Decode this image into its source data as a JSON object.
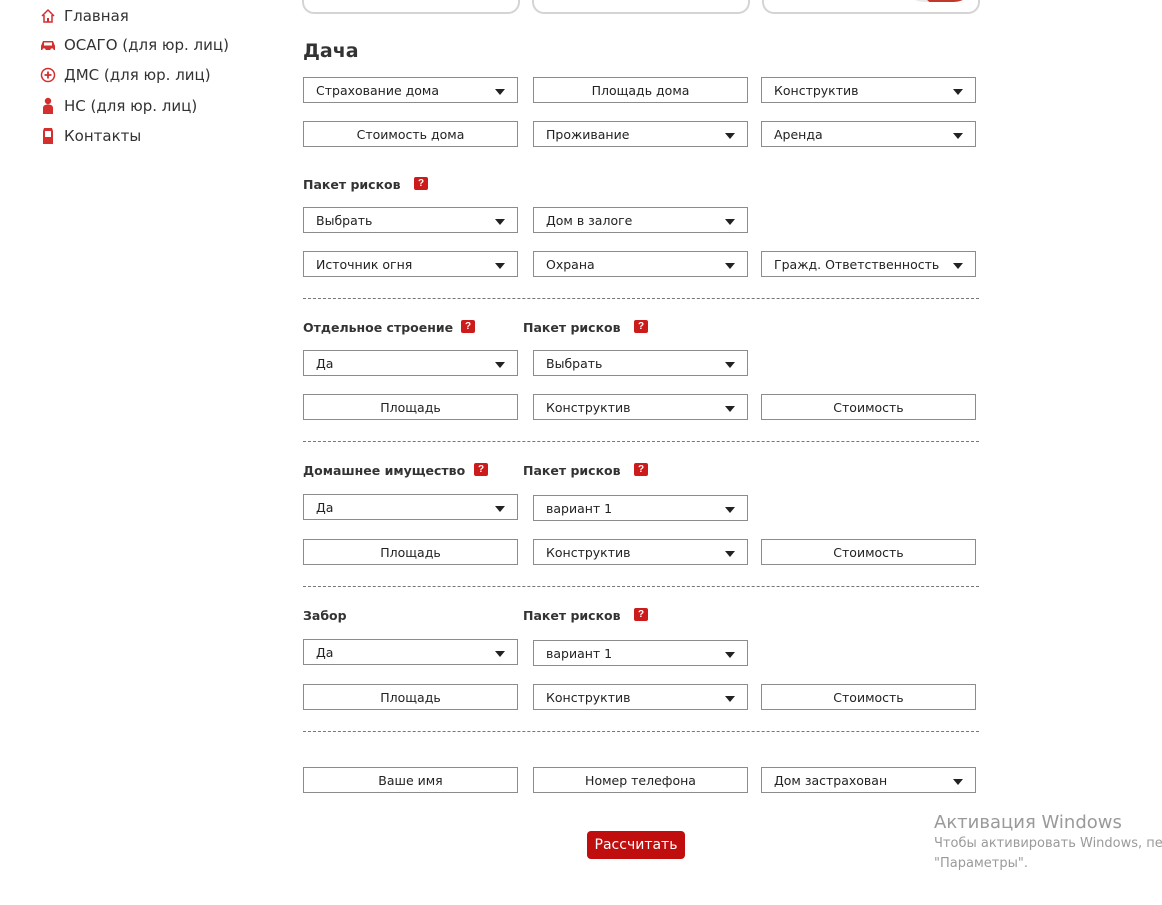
{
  "sidebar": {
    "items": [
      {
        "label": "Главная",
        "icon": "home-icon"
      },
      {
        "label": "ОСАГО (для юр. лиц)",
        "icon": "car-icon"
      },
      {
        "label": "ДМС (для юр. лиц)",
        "icon": "medical-cross-icon"
      },
      {
        "label": "НС (для юр. лиц)",
        "icon": "person-icon"
      },
      {
        "label": "Контакты",
        "icon": "phone-icon"
      }
    ],
    "accent_color": "#d32f2f"
  },
  "section": {
    "title": "Дача"
  },
  "main": {
    "row1": [
      {
        "type": "select",
        "value": "Страхование дома"
      },
      {
        "type": "input",
        "placeholder": "Площадь дома"
      },
      {
        "type": "select",
        "value": "Конструктив"
      }
    ],
    "row2": [
      {
        "type": "input",
        "placeholder": "Стоимость дома"
      },
      {
        "type": "select",
        "value": "Проживание"
      },
      {
        "type": "select",
        "value": "Аренда"
      }
    ],
    "risks": {
      "label": "Пакет рисков",
      "help": "?",
      "row1": [
        {
          "type": "select",
          "value": "Выбрать"
        },
        {
          "type": "select",
          "value": "Дом в залоге"
        }
      ],
      "row2": [
        {
          "type": "select",
          "value": "Источник огня"
        },
        {
          "type": "select",
          "value": "Охрана"
        },
        {
          "type": "select",
          "value": "Гражд. Ответственность"
        }
      ]
    }
  },
  "building": {
    "label": "Отдельное строение",
    "help": "?",
    "package_label": "Пакет рисков",
    "row1": [
      {
        "type": "select",
        "value": "Да"
      },
      {
        "type": "select",
        "value": "Выбрать"
      }
    ],
    "row2": [
      {
        "type": "input",
        "placeholder": "Площадь"
      },
      {
        "type": "select",
        "value": "Конструктив"
      },
      {
        "type": "input",
        "placeholder": "Стоимость"
      }
    ]
  },
  "property": {
    "label": "Домашнее имущество",
    "help": "?",
    "package_label": "Пакет рисков",
    "row1": [
      {
        "type": "select",
        "value": "Да"
      },
      {
        "type": "select",
        "value": "вариант 1"
      }
    ],
    "row2": [
      {
        "type": "input",
        "placeholder": "Площадь"
      },
      {
        "type": "select",
        "value": "Конструктив"
      },
      {
        "type": "input",
        "placeholder": "Стоимость"
      }
    ]
  },
  "fence": {
    "label": "Забор",
    "package_label": "Пакет рисков",
    "help": "?",
    "row1": [
      {
        "type": "select",
        "value": "Да"
      },
      {
        "type": "select",
        "value": "вариант 1"
      }
    ],
    "row2": [
      {
        "type": "input",
        "placeholder": "Площадь"
      },
      {
        "type": "select",
        "value": "Конструктив"
      },
      {
        "type": "input",
        "placeholder": "Стоимость"
      }
    ]
  },
  "contact": {
    "name_placeholder": "Ваше имя",
    "phone_placeholder": "Номер телефона",
    "insured_value": "Дом застрахован"
  },
  "calculate_button": {
    "label": "Рассчитать",
    "color": "#c00d0d"
  },
  "watermark": {
    "title": "Активация Windows",
    "line1": "Чтобы активировать Windows, пе",
    "line2": "\"Параметры\"."
  }
}
